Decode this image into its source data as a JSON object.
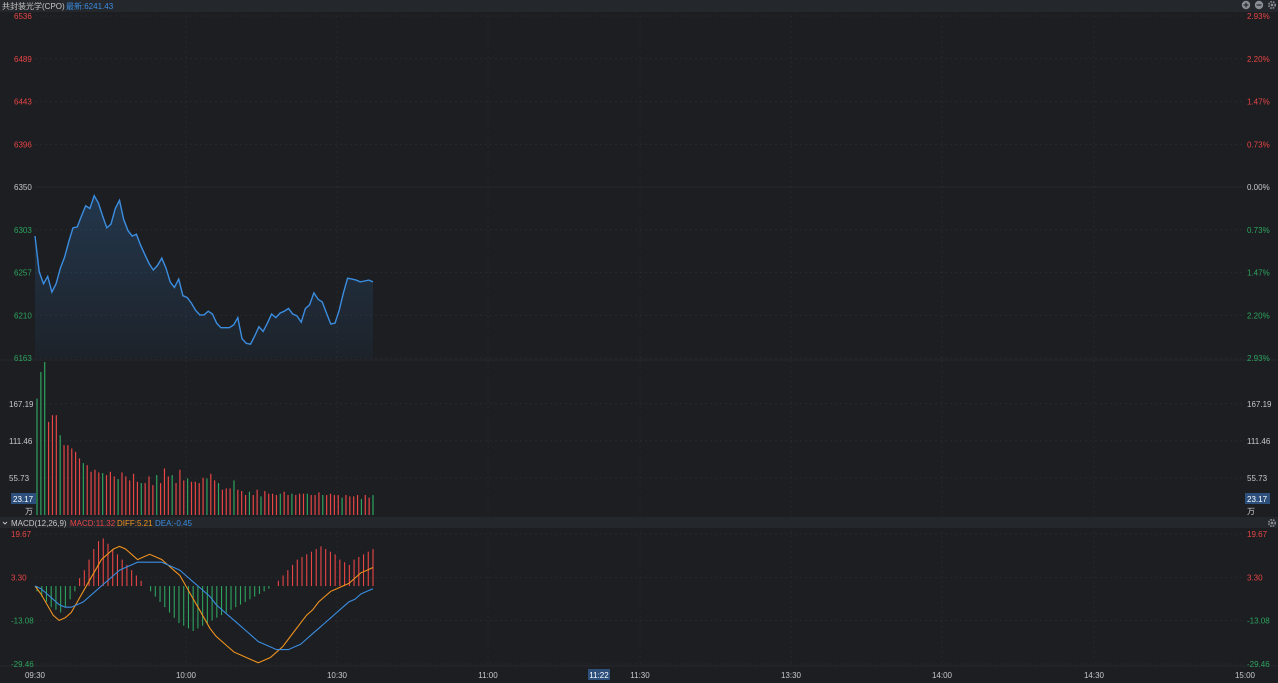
{
  "header": {
    "title": "共封装光学(CPO)",
    "latest_label": "最新:6241.43"
  },
  "macd_header": {
    "collapse_icon": "chevron-down-icon",
    "name": "MACD(12,26,9)",
    "macd_label": "MACD:11.32",
    "diff_label": "DIFF:5.21",
    "dea_label": "DEA:-0.45"
  },
  "volume_unit": "万",
  "icons": {
    "add": "plus-circle-icon",
    "remove": "minus-circle-icon",
    "settings": "gear-icon"
  },
  "colors": {
    "background": "#1c1e22",
    "up": "#e84545",
    "down": "#2ea45e",
    "price_line": "#3b8de0",
    "diff_line": "#f0921e",
    "dea_line": "#3b8de0",
    "title_text": "#c8c8c8",
    "highlight_box": "#2c4f7c"
  },
  "chart_data": [
    {
      "type": "line",
      "name": "price",
      "y_ticks_left": [
        "6536",
        "6489",
        "6443",
        "6396",
        "6350",
        "6303",
        "6257",
        "6210",
        "6163"
      ],
      "y_ticks_right": [
        "2.93%",
        "2.20%",
        "1.47%",
        "0.73%",
        "0.00%",
        "0.73%",
        "1.47%",
        "2.20%",
        "2.93%"
      ],
      "ylim": [
        6163,
        6536
      ],
      "x_labels": [
        "09:30",
        "10:00",
        "10:30",
        "11:00",
        "11:22",
        "11:30",
        "13:30",
        "14:00",
        "14:30",
        "15:00"
      ],
      "highlighted_time": "11:22",
      "x_minutes": [
        0,
        1,
        2,
        3,
        4,
        5,
        6,
        7,
        8,
        9,
        10,
        11,
        12,
        13,
        14,
        15,
        16,
        17,
        18,
        19,
        20,
        21,
        22,
        23,
        24,
        25,
        26,
        27,
        28,
        29,
        30,
        31,
        32,
        33,
        34,
        35,
        36,
        37,
        38,
        39,
        40,
        41,
        42,
        43,
        44,
        45,
        46,
        47,
        48,
        49,
        50,
        51,
        52,
        53,
        54,
        55,
        56,
        57,
        58,
        59,
        60,
        61,
        62,
        63,
        64,
        65,
        66,
        67
      ],
      "values": [
        6296,
        6257,
        6244,
        6252,
        6235,
        6244,
        6261,
        6273,
        6290,
        6305,
        6306,
        6318,
        6329,
        6326,
        6340,
        6332,
        6318,
        6305,
        6309,
        6326,
        6335,
        6314,
        6302,
        6296,
        6298,
        6286,
        6276,
        6266,
        6259,
        6264,
        6272,
        6261,
        6246,
        6240,
        6249,
        6231,
        6229,
        6223,
        6215,
        6210,
        6210,
        6214,
        6211,
        6201,
        6196,
        6196,
        6196,
        6199,
        6207,
        6184,
        6179,
        6178,
        6187,
        6197,
        6192,
        6201,
        6211,
        6207,
        6212,
        6214,
        6217,
        6211,
        6209,
        6202,
        6217,
        6221,
        6234,
        6227,
        6224,
        6212,
        6200,
        6201,
        6215,
        6234,
        6250,
        6249,
        6248,
        6246,
        6247,
        6248,
        6246
      ]
    },
    {
      "type": "bar",
      "name": "volume",
      "y_ticks": [
        "167.19",
        "111.46",
        "55.73"
      ],
      "current_value": "23.17",
      "unit": "万",
      "ylim": [
        0,
        230
      ],
      "values": [
        175,
        215,
        230,
        140,
        150,
        150,
        120,
        105,
        105,
        100,
        95,
        85,
        78,
        75,
        65,
        68,
        64,
        63,
        60,
        65,
        58,
        54,
        64,
        58,
        52,
        62,
        50,
        48,
        48,
        58,
        45,
        60,
        48,
        70,
        58,
        60,
        48,
        68,
        52,
        55,
        50,
        50,
        48,
        56,
        55,
        62,
        52,
        48,
        38,
        40,
        40,
        52,
        38,
        36,
        30,
        35,
        30,
        38,
        28,
        36,
        32,
        32,
        30,
        32,
        35,
        30,
        32,
        30,
        32,
        32,
        32,
        30,
        30,
        34,
        30,
        30,
        32,
        30,
        30,
        26,
        30,
        28,
        28,
        30,
        24,
        30,
        26,
        30
      ],
      "colors_down_idx": [
        0,
        1,
        2,
        6,
        12,
        17,
        21,
        27,
        31,
        35,
        39,
        44,
        47,
        51,
        55,
        58,
        63,
        66,
        70,
        74,
        79,
        84,
        87
      ]
    },
    {
      "type": "bar+line",
      "name": "MACD",
      "y_ticks": [
        "19.67",
        "3.30",
        "-13.08",
        "-29.46"
      ],
      "ylim": [
        -29.46,
        19.67
      ],
      "histogram": [
        -2,
        -4,
        -6,
        -8,
        -9,
        -10,
        -8,
        -5,
        -2,
        3,
        6,
        10,
        14,
        17,
        18,
        16,
        14,
        12,
        10,
        8,
        6,
        4,
        2,
        0,
        -2,
        -4,
        -6,
        -8,
        -10,
        -12,
        -14,
        -15,
        -16,
        -17,
        -16,
        -15,
        -14,
        -13,
        -12,
        -11,
        -10,
        -9,
        -8,
        -7,
        -6,
        -5,
        -4,
        -3,
        -2,
        -1,
        0,
        2,
        4,
        6,
        8,
        10,
        11,
        12,
        13,
        14,
        15,
        14,
        13,
        12,
        10,
        9,
        8,
        10,
        11,
        12,
        13,
        14
      ],
      "diff": [
        0,
        -3,
        -7,
        -11,
        -13,
        -12,
        -10,
        -6,
        -2,
        2,
        6,
        10,
        12,
        14,
        15,
        14,
        12,
        10,
        11,
        12,
        11,
        10,
        8,
        6,
        4,
        0,
        -4,
        -8,
        -12,
        -16,
        -19,
        -21,
        -23,
        -25,
        -26,
        -27,
        -28,
        -29,
        -28,
        -27,
        -25,
        -23,
        -20,
        -17,
        -14,
        -11,
        -9,
        -6,
        -4,
        -2,
        -1,
        0,
        1,
        3,
        5,
        6,
        7
      ],
      "dea": [
        0,
        -1,
        -3,
        -5,
        -7,
        -8,
        -8,
        -7,
        -6,
        -4,
        -2,
        0,
        2,
        4,
        6,
        7,
        8,
        9,
        9,
        9,
        9,
        9,
        8,
        7,
        6,
        4,
        2,
        0,
        -2,
        -4,
        -7,
        -9,
        -11,
        -13,
        -15,
        -17,
        -19,
        -21,
        -22,
        -23,
        -24,
        -24,
        -24,
        -23,
        -22,
        -20,
        -18,
        -16,
        -14,
        -12,
        -10,
        -8,
        -6,
        -5,
        -3,
        -2,
        -1
      ]
    }
  ]
}
